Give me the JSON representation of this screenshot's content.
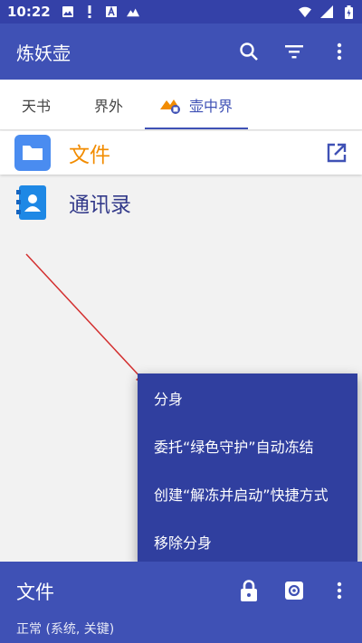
{
  "status_bar": {
    "time": "10:22",
    "left_icons": [
      "image-icon",
      "alert-icon",
      "a-box-icon",
      "mountain-icon"
    ],
    "right_icons": [
      "wifi-icon",
      "signal-icon",
      "battery-charging-icon"
    ]
  },
  "app_bar": {
    "title": "炼妖壶",
    "actions": [
      "search-icon",
      "filter-icon",
      "more-vert-icon"
    ]
  },
  "tabs": [
    {
      "label": "天书",
      "active": false
    },
    {
      "label": "界外",
      "active": false
    },
    {
      "label": "壶中界",
      "active": true,
      "icon": "island-badge-icon"
    }
  ],
  "apps": [
    {
      "name": "文件",
      "icon": "folder-app-icon",
      "selected": true,
      "action_icon": "open-in-new-icon"
    },
    {
      "name": "通讯录",
      "icon": "contacts-app-icon",
      "selected": false
    }
  ],
  "menu": {
    "items": [
      "分身",
      "委托“绿色守护”自动冻结",
      "创建“解冻并启动”快捷方式",
      "移除分身"
    ]
  },
  "bottom_panel": {
    "title": "文件",
    "subtitle": "正常 (系统, 关键)",
    "actions": [
      "lock-icon",
      "settings-icon",
      "more-vert-icon"
    ]
  },
  "colors": {
    "primary": "#3f51b5",
    "primary_dark": "#3441a8",
    "menu_bg": "#303f9f",
    "accent_orange": "#f28c00",
    "annotation_red": "#d32f2f"
  }
}
